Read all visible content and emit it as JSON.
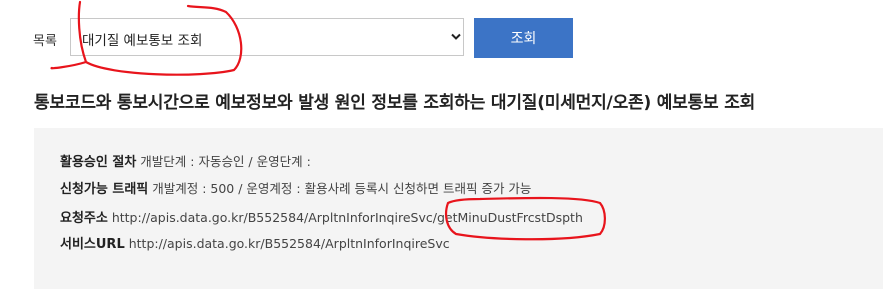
{
  "list_label": "목록",
  "select": {
    "value": "대기질 예보통보 조회"
  },
  "search_button": "조회",
  "title": "통보코드와 통보시간으로 예보정보와 발생 원인 정보를 조회하는 대기질(미세먼지/오존) 예보통보 조회",
  "info": {
    "approval_label": "활용승인 절차",
    "approval_value": "개발단계 : 자동승인 / 운영단계 :",
    "traffic_label": "신청가능 트래픽",
    "traffic_value": "개발계정 : 500 / 운영계정 : 활용사례 등록시 신청하면 트래픽 증가 가능",
    "request_label": "요청주소",
    "request_url_base": "http://apis.data.go.kr/B552584/ArpltnInforInqireSvc/",
    "request_url_op": "getMinuDustFrcstDspth",
    "service_label": "서비스URL",
    "service_url": "http://apis.data.go.kr/B552584/ArpltnInforInqireSvc"
  },
  "annotation_color": "#e8141c",
  "accent_color": "#3c74c6"
}
